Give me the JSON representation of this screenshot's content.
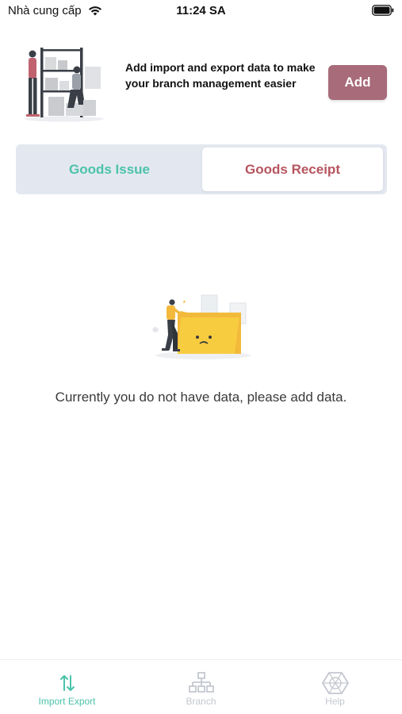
{
  "status_bar": {
    "carrier": "Nhà cung cấp",
    "time": "11:24 SA"
  },
  "promo": {
    "text": "Add import and export data to make your branch management easier",
    "add_label": "Add"
  },
  "tabs": [
    {
      "label": "Goods Issue",
      "selected": false
    },
    {
      "label": "Goods Receipt",
      "selected": true
    }
  ],
  "empty_state": {
    "message": "Currently you do not have data, please add data."
  },
  "bottom_nav": [
    {
      "label": "Import Export",
      "icon": "import-export-icon",
      "active": true
    },
    {
      "label": "Branch",
      "icon": "branch-icon",
      "active": false
    },
    {
      "label": "Help",
      "icon": "help-icon",
      "active": false
    }
  ],
  "colors": {
    "accent_teal": "#4cc2ab",
    "accent_rose": "#a86b79",
    "receipt_red": "#b6545e",
    "tab_bg": "#e3e8f0"
  }
}
